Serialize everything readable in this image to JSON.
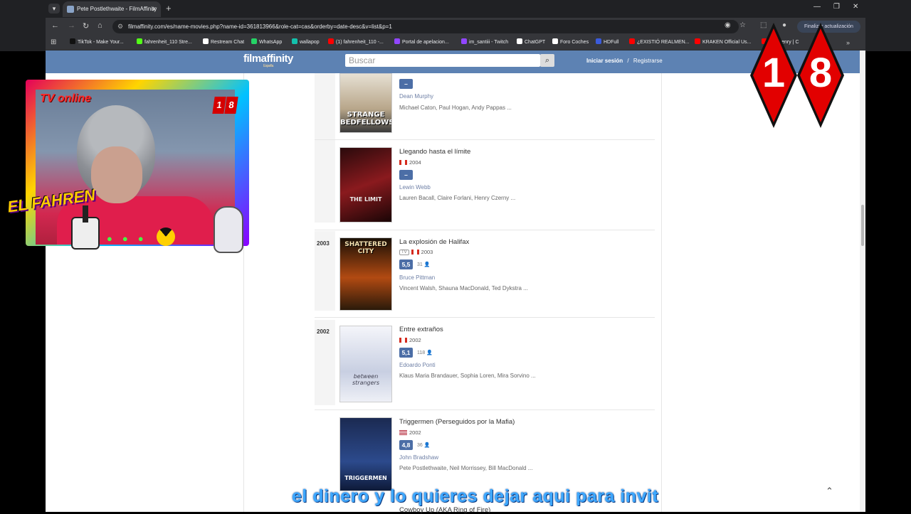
{
  "browser": {
    "tab_title": "Pete Postlethwaite - FilmAffinity",
    "tab_close": "✕",
    "new_tab": "+",
    "url": "filmaffinity.com/es/name-movies.php?name-id=361813966&role-cat=cas&orderby=date-desc&v=list&p=1",
    "update_label": "Finalizar actualización",
    "win_min": "—",
    "win_max": "❐",
    "win_close": "✕"
  },
  "bookmarks": [
    {
      "label": "TikTok - Make Your...",
      "color": "#111111"
    },
    {
      "label": "fahrenheit_110 Stre...",
      "color": "#53fc18"
    },
    {
      "label": "Restream Chat",
      "color": "#ffffff"
    },
    {
      "label": "WhatsApp",
      "color": "#25d366"
    },
    {
      "label": "wallapop",
      "color": "#13c1ac"
    },
    {
      "label": "(1) fahrenheit_110 -...",
      "color": "#ff0000"
    },
    {
      "label": "Portal de apelacion...",
      "color": "#9146ff"
    },
    {
      "label": "im_santiii - Twitch",
      "color": "#9146ff"
    },
    {
      "label": "ChatGPT",
      "color": "#ffffff"
    },
    {
      "label": "Foro Coches",
      "color": "#ffffff"
    },
    {
      "label": "HDFull",
      "color": "#3b5bdb"
    },
    {
      "label": "¿EXISTIÓ REALMEN...",
      "color": "#ff0000"
    },
    {
      "label": "KRAKEN Official Us...",
      "color": "#ff0000"
    },
    {
      "label": "ore Henry | C",
      "color": "#ff0000"
    }
  ],
  "site": {
    "logo": "filmaffinity",
    "logo_sub": "España",
    "search_placeholder": "Buscar",
    "login": "Iniciar sesión",
    "separator": "/",
    "register": "Registrarse"
  },
  "movies": [
    {
      "year_group": "",
      "title": "",
      "country": "",
      "year": "",
      "rating": "–",
      "votes": "",
      "director": "Dean Murphy",
      "cast": "Michael Caton, Paul Hogan, Andy Pappas ...",
      "poster_text": "STRANGE BEDFELLOWS",
      "poster_color": "#c9b8a0"
    },
    {
      "year_group": "",
      "title": "Llegando hasta el límite",
      "country": "ca",
      "year": "2004",
      "rating": "–",
      "votes": "",
      "director": "Lewin Webb",
      "cast": "Lauren Bacall, Claire Forlani, Henry Czerny ...",
      "poster_text": "THE LIMIT",
      "poster_color": "#7a1418"
    },
    {
      "year_group": "2003",
      "title": "La explosión de Halifax",
      "tv": "TV",
      "country": "ca",
      "year": "2003",
      "rating": "5,5",
      "votes": "31",
      "director": "Bruce Pittman",
      "cast": "Vincent Walsh, Shauna MacDonald, Ted Dykstra ...",
      "poster_text": "SHATTERED CITY",
      "poster_color": "#8a3a10"
    },
    {
      "year_group": "2002",
      "title": "Entre extraños",
      "country": "ca",
      "year": "2002",
      "rating": "5,1",
      "votes": "118",
      "director": "Edoardo Ponti",
      "cast": "Klaus Maria Brandauer, Sophia Loren, Mira Sorvino ...",
      "poster_text": "between strangers",
      "poster_color": "#dfe4ef"
    },
    {
      "year_group": "",
      "title": "Triggermen (Perseguidos por la Mafia)",
      "country": "us",
      "year": "2002",
      "rating": "4,8",
      "votes": "36",
      "director": "John Bradshaw",
      "cast": "Pete Postlethwaite, Neil Morrissey, Bill MacDonald ...",
      "poster_text": "TRIGGERMEN",
      "poster_color": "#1f3a7a"
    }
  ],
  "next_title": "Cowboy Up (AKA Ring of Fire)",
  "overlay": {
    "cam_label": "TV online",
    "cam_badge_1": "1",
    "cam_badge_2": "8",
    "brand": "EL FAHREN",
    "big_1": "1",
    "big_8": "8",
    "subtitle": "el dinero y lo quieres dejar aqui para invit"
  }
}
